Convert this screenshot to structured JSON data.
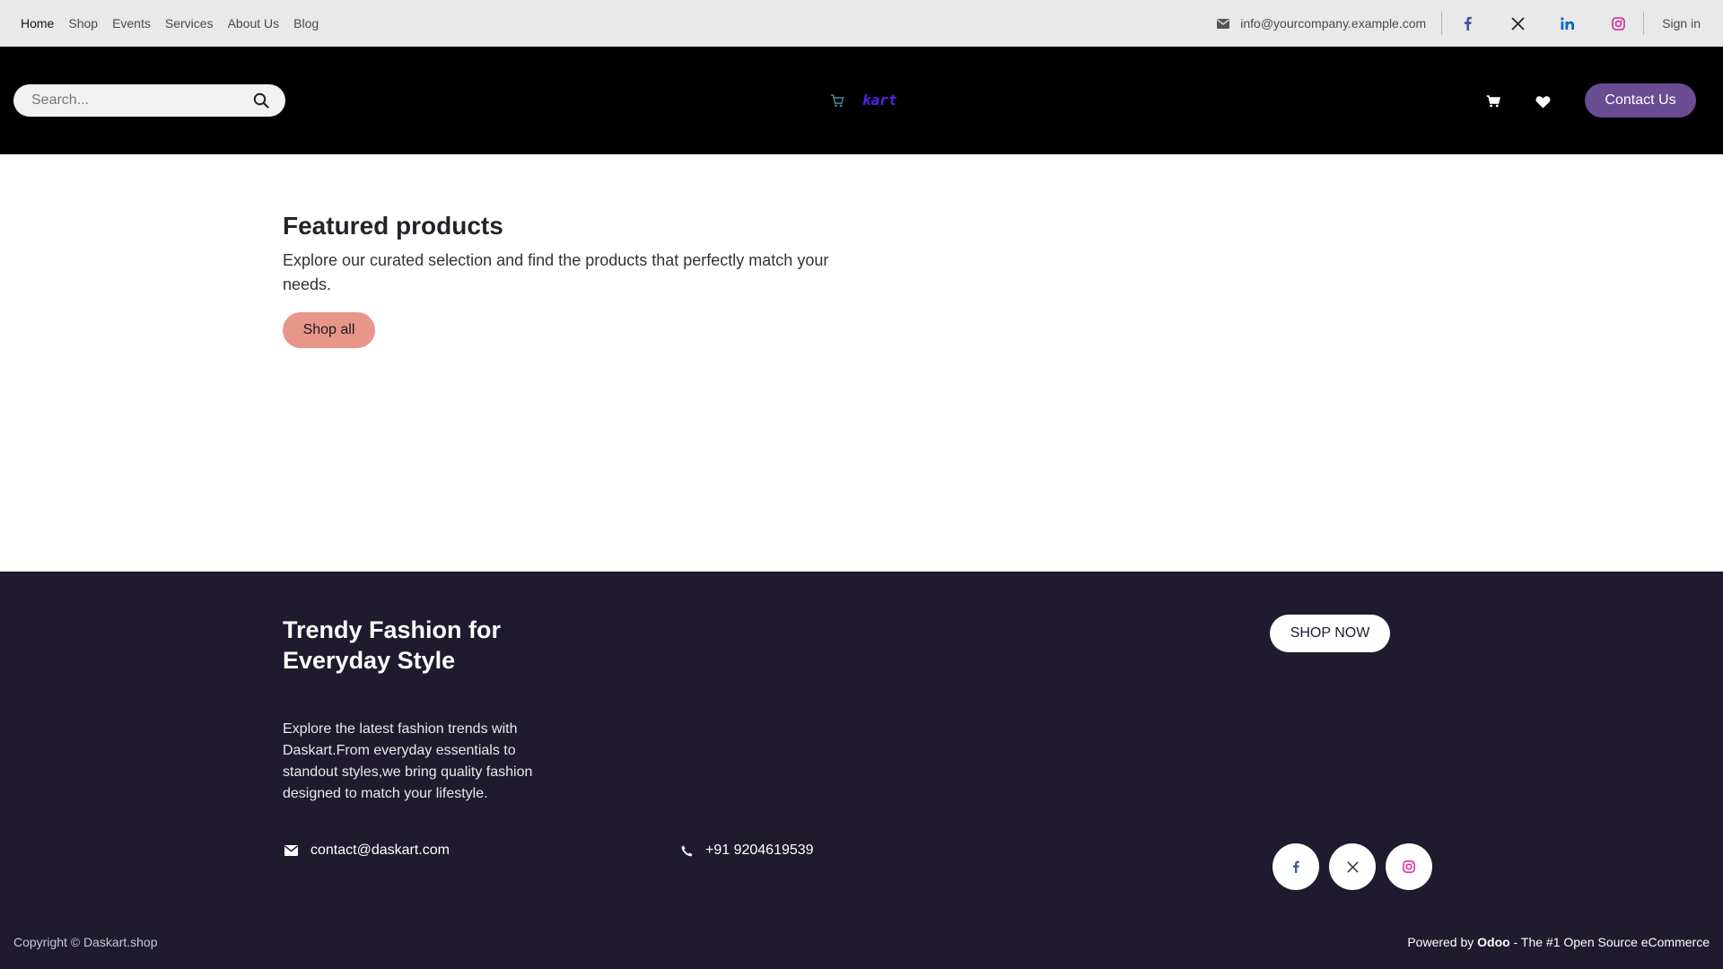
{
  "topbar": {
    "nav": [
      {
        "label": "Home"
      },
      {
        "label": "Shop"
      },
      {
        "label": "Events"
      },
      {
        "label": "Services"
      },
      {
        "label": "About Us"
      },
      {
        "label": "Blog"
      }
    ],
    "email": "info@yourcompany.example.com",
    "sign_in": "Sign in",
    "socials": [
      "facebook-icon",
      "x-icon",
      "linkedin-icon",
      "instagram-icon"
    ]
  },
  "header": {
    "search_placeholder": "Search...",
    "logo_text": "kart",
    "contact_label": "Contact Us"
  },
  "featured": {
    "title": "Featured products",
    "description": "Explore our curated selection and find the products that perfectly match your needs.",
    "button": "Shop all"
  },
  "footer": {
    "title": "Trendy Fashion for Everyday Style",
    "description": "Explore the latest fashion trends with Daskart.From everyday essentials to standout styles,we bring quality fashion designed to match your lifestyle.",
    "email": "contact@daskart.com",
    "phone": "+91 9204619539",
    "shop_now": "SHOP NOW",
    "copyright": "Copyright © Daskart.shop",
    "powered_prefix": "Powered by",
    "powered_brand": "Odoo",
    "powered_suffix": "- The #1 Open Source eCommerce"
  },
  "colors": {
    "accent": "#6a4c93",
    "footer_bg": "#1f1a2e",
    "shop_all_bg": "#e8958a",
    "facebook": "#3b5998",
    "linkedin": "#0a66c2",
    "instagram": "#d6249f"
  }
}
